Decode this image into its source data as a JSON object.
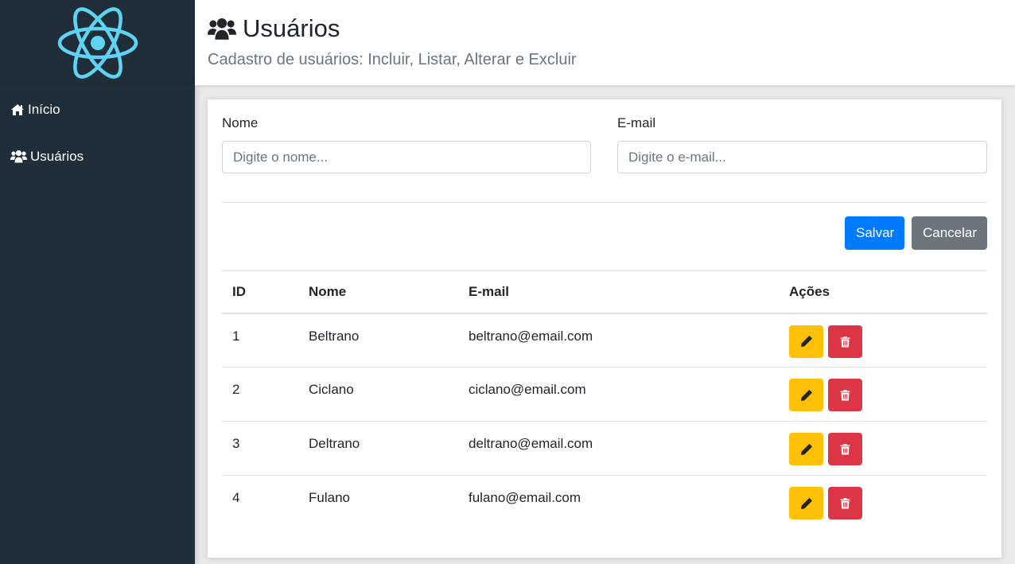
{
  "sidebar": {
    "logo_icon": "react-atom-icon",
    "items": [
      {
        "label": "Início",
        "icon": "home-icon"
      },
      {
        "label": "Usuários",
        "icon": "users-icon"
      }
    ]
  },
  "header": {
    "title": "Usuários",
    "title_icon": "users-icon",
    "subtitle": "Cadastro de usuários: Incluir, Listar, Alterar e Excluir"
  },
  "form": {
    "name_label": "Nome",
    "name_placeholder": "Digite o nome...",
    "name_value": "",
    "email_label": "E-mail",
    "email_placeholder": "Digite o e-mail...",
    "email_value": "",
    "save_label": "Salvar",
    "cancel_label": "Cancelar"
  },
  "table": {
    "headers": [
      "ID",
      "Nome",
      "E-mail",
      "Ações"
    ],
    "rows": [
      {
        "id": "1",
        "name": "Beltrano",
        "email": "beltrano@email.com"
      },
      {
        "id": "2",
        "name": "Ciclano",
        "email": "ciclano@email.com"
      },
      {
        "id": "3",
        "name": "Deltrano",
        "email": "deltrano@email.com"
      },
      {
        "id": "4",
        "name": "Fulano",
        "email": "fulano@email.com"
      }
    ],
    "row_actions": {
      "edit_icon": "pencil-icon",
      "delete_icon": "trash-icon"
    }
  },
  "colors": {
    "sidebar_bg": "#1f2e38",
    "logo": "#5ed3f3",
    "primary": "#007bff",
    "secondary": "#6c757d",
    "warning": "#ffc107",
    "danger": "#dc3545"
  }
}
